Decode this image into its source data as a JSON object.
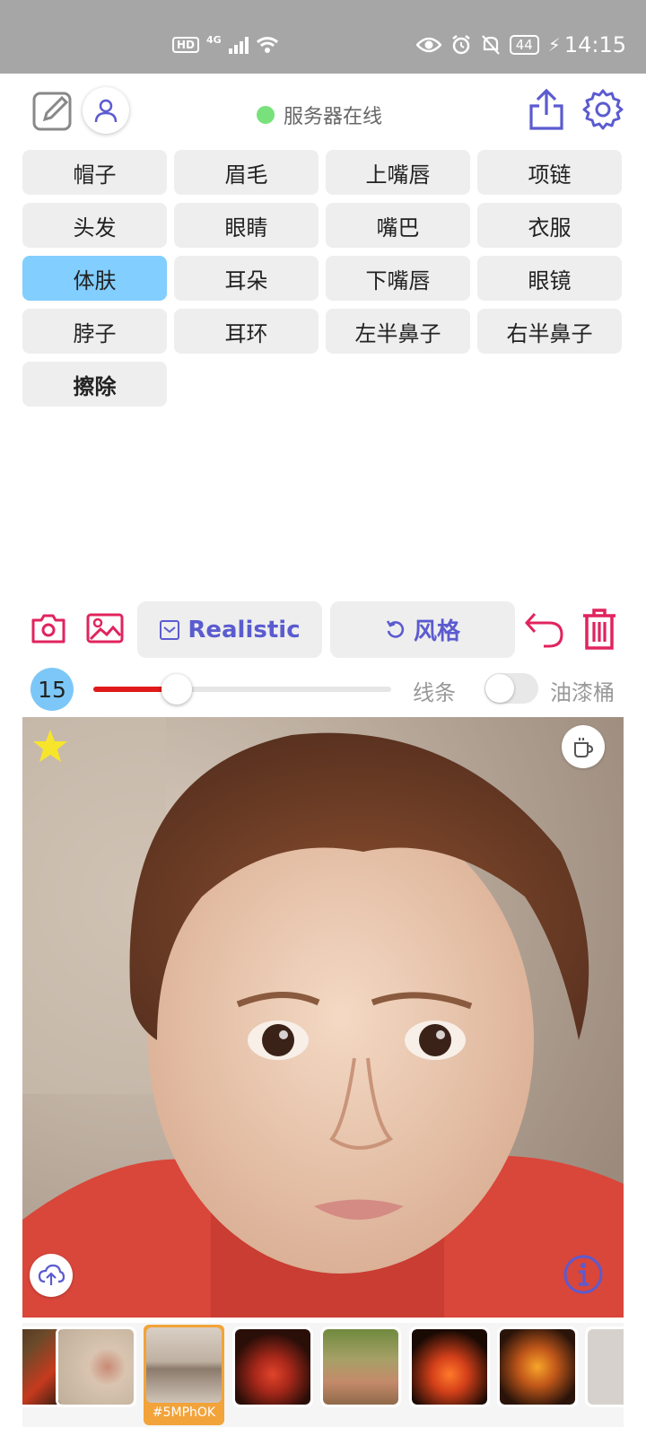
{
  "status_bar": {
    "hd": "HD",
    "network": "4G",
    "battery": "44",
    "time": "14:15"
  },
  "header": {
    "server_status": "服务器在线"
  },
  "categories": [
    {
      "label": "帽子"
    },
    {
      "label": "眉毛"
    },
    {
      "label": "上嘴唇"
    },
    {
      "label": "项链"
    },
    {
      "label": "头发"
    },
    {
      "label": "眼睛"
    },
    {
      "label": "嘴巴"
    },
    {
      "label": "衣服"
    },
    {
      "label": "体肤",
      "active": true
    },
    {
      "label": "耳朵"
    },
    {
      "label": "下嘴唇"
    },
    {
      "label": "眼镜"
    },
    {
      "label": "脖子"
    },
    {
      "label": "耳环"
    },
    {
      "label": "左半鼻子"
    },
    {
      "label": "右半鼻子"
    },
    {
      "label": "擦除"
    }
  ],
  "toolbar": {
    "style_model_label": "Realistic",
    "style_label": "风格"
  },
  "brush": {
    "size": "15",
    "slider_fraction": 0.28,
    "line_label": "线条",
    "bucket_label": "油漆桶",
    "bucket_enabled": false
  },
  "thumbnails": {
    "selected_caption": "#5MPhOK"
  },
  "colors": {
    "accent_purple": "#5b5bd0",
    "accent_red": "#e0245e",
    "active_category": "#82ceff",
    "online_dot": "#79e17c",
    "selected_thumb": "#f2a33a"
  }
}
